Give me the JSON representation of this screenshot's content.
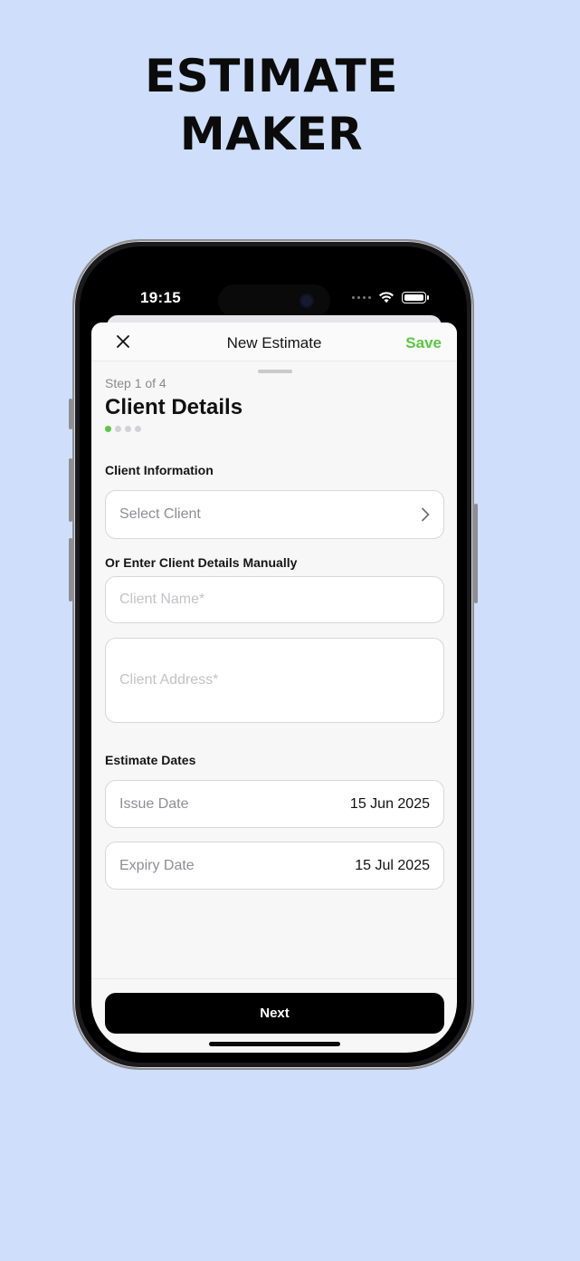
{
  "hero": {
    "line1": "ESTIMATE",
    "line2": "MAKER"
  },
  "status": {
    "time": "19:15"
  },
  "nav": {
    "title": "New Estimate",
    "save_label": "Save"
  },
  "header": {
    "step": "Step 1 of 4",
    "title": "Client Details",
    "progress_total": 4,
    "progress_current": 1
  },
  "client_section": {
    "label": "Client Information",
    "select_placeholder": "Select Client",
    "manual_label": "Or Enter Client Details Manually",
    "name_placeholder": "Client Name*",
    "address_placeholder": "Client Address*"
  },
  "dates_section": {
    "label": "Estimate Dates",
    "issue_label": "Issue Date",
    "issue_value": "15 Jun 2025",
    "expiry_label": "Expiry Date",
    "expiry_value": "15 Jul 2025"
  },
  "footer": {
    "next_label": "Next"
  },
  "colors": {
    "accent": "#5cc546",
    "background": "#cfdffb",
    "button": "#000000"
  },
  "icons": [
    "close-icon",
    "chevron-right-icon",
    "wifi-icon",
    "battery-icon",
    "signal-dots-icon"
  ]
}
